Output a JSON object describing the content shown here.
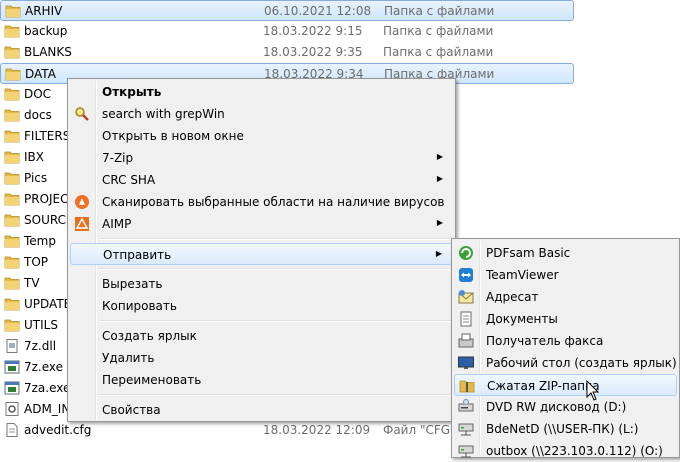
{
  "files": [
    {
      "name": "ARHIV",
      "date": "06.10.2021 12:08",
      "type": "Папка с файлами",
      "icon": "folder-icon",
      "selected": true
    },
    {
      "name": "backup",
      "date": "18.03.2022 9:15",
      "type": "Папка с файлами",
      "icon": "folder-icon"
    },
    {
      "name": "BLANKS",
      "date": "18.03.2022 9:35",
      "type": "Папка с файлами",
      "icon": "folder-icon"
    },
    {
      "name": "DATA",
      "date": "18.03.2022 9:34",
      "type": "Папка с файлами",
      "icon": "folder-icon",
      "selected": true
    },
    {
      "name": "DOC",
      "date": "",
      "type": "",
      "icon": "folder-icon"
    },
    {
      "name": "docs",
      "date": "",
      "type": "",
      "icon": "folder-icon"
    },
    {
      "name": "FILTERS",
      "date": "",
      "type": "",
      "icon": "folder-icon"
    },
    {
      "name": "IBX",
      "date": "",
      "type": "",
      "icon": "folder-icon"
    },
    {
      "name": "Pics",
      "date": "",
      "type": "",
      "icon": "folder-icon"
    },
    {
      "name": "PROJECT",
      "date": "",
      "type": "",
      "icon": "folder-icon"
    },
    {
      "name": "SOURCE",
      "date": "",
      "type": "",
      "icon": "folder-icon"
    },
    {
      "name": "Temp",
      "date": "",
      "type": "",
      "icon": "folder-icon"
    },
    {
      "name": "TOP",
      "date": "",
      "type": "",
      "icon": "folder-icon"
    },
    {
      "name": "TV",
      "date": "",
      "type": "",
      "icon": "folder-icon"
    },
    {
      "name": "UPDATE",
      "date": "",
      "type": "",
      "icon": "folder-icon"
    },
    {
      "name": "UTILS",
      "date": "",
      "type": "",
      "icon": "folder-icon"
    },
    {
      "name": "7z.dll",
      "date": "",
      "type": "",
      "icon": "dll-file-icon"
    },
    {
      "name": "7z.exe",
      "date": "",
      "type": "",
      "icon": "exe-file-icon"
    },
    {
      "name": "7za.exe",
      "date": "",
      "type": "",
      "icon": "exe-file-icon"
    },
    {
      "name": "ADM_IN",
      "date": "",
      "type": "",
      "icon": "gear-file-icon"
    },
    {
      "name": "advedit.cfg",
      "date": "18.03.2022 12:09",
      "type": "Файл \"CFG\"",
      "icon": "document-file-icon"
    }
  ],
  "context_menu": {
    "items": [
      {
        "label": "Открыть",
        "bold": true,
        "icon": ""
      },
      {
        "label": "search with grepWin",
        "icon": "magnifier-icon"
      },
      {
        "label": "Открыть в новом окне",
        "icon": ""
      },
      {
        "label": "7-Zip",
        "submenu": true,
        "icon": ""
      },
      {
        "label": "CRC SHA",
        "submenu": true,
        "icon": ""
      },
      {
        "label": "Сканировать выбранные области на наличие вирусов",
        "icon": "avast-icon"
      },
      {
        "label": "AIMP",
        "submenu": true,
        "icon": "aimp-icon"
      },
      {
        "sep": true
      },
      {
        "label": "Отправить",
        "submenu": true,
        "hover": true,
        "icon": ""
      },
      {
        "sep": true
      },
      {
        "label": "Вырезать",
        "icon": ""
      },
      {
        "label": "Копировать",
        "icon": ""
      },
      {
        "sep": true
      },
      {
        "label": "Создать ярлык",
        "icon": ""
      },
      {
        "label": "Удалить",
        "icon": ""
      },
      {
        "label": "Переименовать",
        "icon": ""
      },
      {
        "sep": true
      },
      {
        "label": "Свойства",
        "icon": ""
      }
    ]
  },
  "sendto_menu": {
    "items": [
      {
        "label": "PDFsam Basic",
        "icon": "pdfsam-icon"
      },
      {
        "label": "TeamViewer",
        "icon": "teamviewer-icon"
      },
      {
        "label": "Адресат",
        "icon": "mail-recipient-icon"
      },
      {
        "label": "Документы",
        "icon": "documents-icon"
      },
      {
        "label": "Получатель факса",
        "icon": "fax-icon"
      },
      {
        "label": "Рабочий стол (создать ярлык)",
        "icon": "desktop-icon"
      },
      {
        "label": "Сжатая ZIP-папка",
        "icon": "zip-folder-icon",
        "hover": true
      },
      {
        "label": "DVD RW дисковод (D:)",
        "icon": "dvd-drive-icon"
      },
      {
        "label": "BdeNetD (\\\\USER-ПК) (L:)",
        "icon": "network-drive-icon"
      },
      {
        "label": "outbox (\\\\223.103.0.112) (O:)",
        "icon": "network-drive-icon"
      }
    ]
  },
  "colors": {
    "selection": "#cfe6fc",
    "menu_bg": "#f0f0f0",
    "folder": "#e8c04a"
  }
}
